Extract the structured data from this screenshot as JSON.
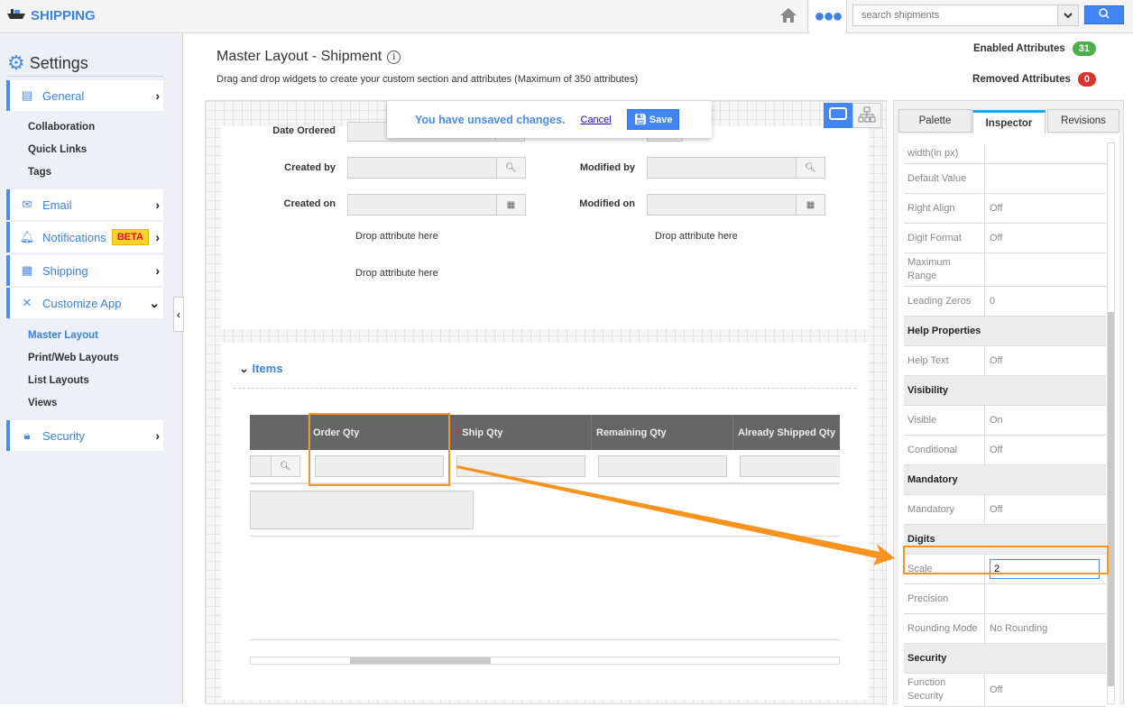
{
  "app": {
    "name": "SHIPPING",
    "search_placeholder": "search shipments"
  },
  "colors": {
    "accent": "#4285f4",
    "highlight": "#f7931e",
    "enabled_badge": "#4cae4c",
    "removed_badge": "#d9342b"
  },
  "sidebar": {
    "title": "Settings",
    "items": [
      {
        "label": "General",
        "icon": "monitor-icon"
      },
      {
        "label": "Email",
        "icon": "envelope-icon"
      },
      {
        "label": "Notifications",
        "icon": "bell-icon",
        "badge": "BETA"
      },
      {
        "label": "Shipping",
        "icon": "shipping-icon"
      },
      {
        "label": "Customize App",
        "icon": "tools-icon"
      },
      {
        "label": "Security",
        "icon": "lock-icon"
      }
    ],
    "general_sub": [
      "Collaboration",
      "Quick Links",
      "Tags"
    ],
    "customize_sub": [
      "Master Layout",
      "Print/Web Layouts",
      "List Layouts",
      "Views"
    ]
  },
  "page": {
    "title": "Master Layout - Shipment",
    "subtitle": "Drag and drop widgets to create your custom section and attributes (Maximum of 350 attributes)",
    "enabled_label": "Enabled Attributes",
    "enabled_count": "31",
    "removed_label": "Removed Attributes",
    "removed_count": "0"
  },
  "toast": {
    "message": "You have unsaved changes.",
    "cancel": "Cancel",
    "save": "Save"
  },
  "form": {
    "date_ordered": "Date Ordered",
    "created_by": "Created by",
    "modified_by": "Modified by",
    "created_on": "Created on",
    "modified_on": "Modified on",
    "drop": "Drop attribute here"
  },
  "items": {
    "title": "Items",
    "columns": [
      "Order Qty",
      "Ship Qty",
      "Remaining Qty",
      "Already Shipped Qty"
    ],
    "required_mark": "*"
  },
  "panel": {
    "tabs": [
      "Palette",
      "Inspector",
      "Revisions"
    ],
    "rows": [
      {
        "k": "width(in px)",
        "v": ""
      },
      {
        "k": "Default Value",
        "v": ""
      },
      {
        "k": "Right Align",
        "v": "Off"
      },
      {
        "k": "Digit Format",
        "v": "Off"
      },
      {
        "k": "Maximum Range",
        "v": ""
      },
      {
        "k": "Leading Zeros",
        "v": "0"
      },
      {
        "section": "Help Properties"
      },
      {
        "k": "Help Text",
        "v": "Off"
      },
      {
        "section": "Visibility"
      },
      {
        "k": "Visible",
        "v": "On"
      },
      {
        "k": "Conditional",
        "v": "Off"
      },
      {
        "section": "Mandatory"
      },
      {
        "k": "Mandatory",
        "v": "Off"
      },
      {
        "section": "Digits"
      },
      {
        "k": "Scale",
        "v": "2",
        "input": true
      },
      {
        "k": "Precision",
        "v": ""
      },
      {
        "k": "Rounding Mode",
        "v": "No Rounding"
      },
      {
        "section": "Security"
      },
      {
        "k": "Function Security",
        "v": "Off"
      }
    ]
  }
}
